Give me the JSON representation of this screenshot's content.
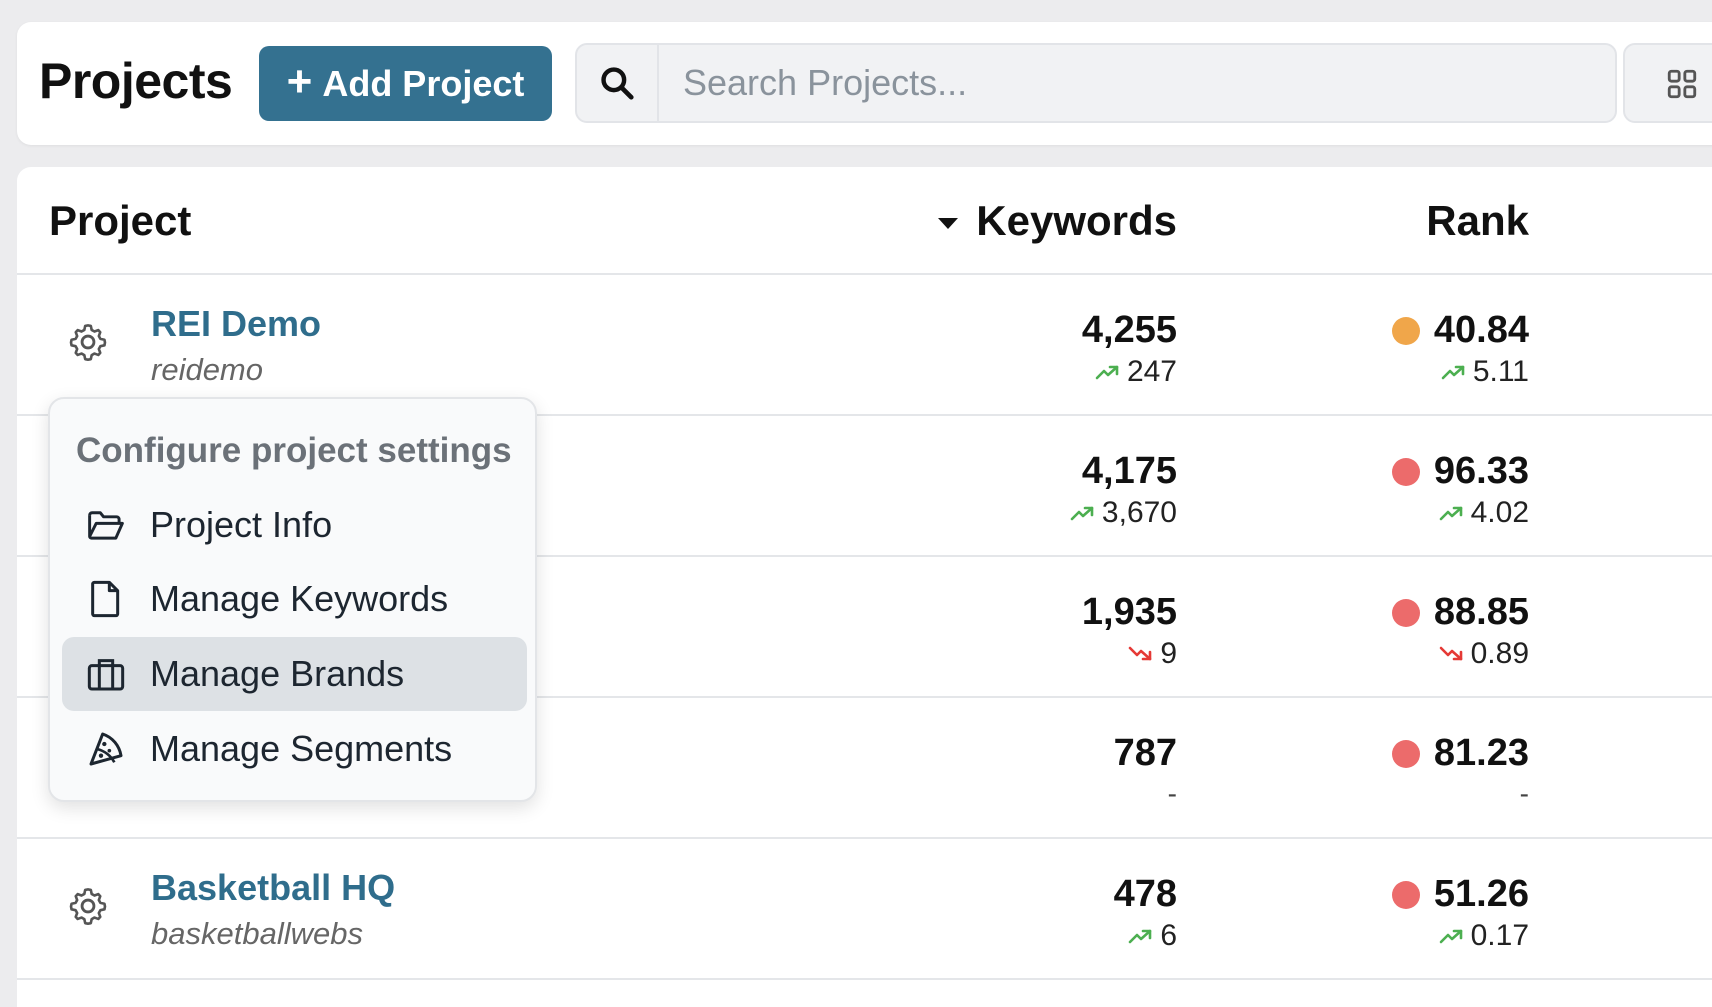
{
  "header": {
    "title": "Projects",
    "add_button_label": "Add Project",
    "search_placeholder": "Search Projects..."
  },
  "table": {
    "columns": {
      "project": "Project",
      "keywords": "Keywords",
      "rank": "Rank"
    },
    "rows": [
      {
        "name": "REI Demo",
        "slug": "reidemo",
        "keywords": "4,255",
        "kw_delta": "247",
        "kw_trend": "up",
        "rank": "40.84",
        "rank_delta": "5.11",
        "rank_trend": "up",
        "rank_color": "#f0a64a"
      },
      {
        "name": "",
        "slug": "",
        "keywords": "4,175",
        "kw_delta": "3,670",
        "kw_trend": "up",
        "rank": "96.33",
        "rank_delta": "4.02",
        "rank_trend": "up",
        "rank_color": "#ec6b6b"
      },
      {
        "name": "",
        "slug": "",
        "keywords": "1,935",
        "kw_delta": "9",
        "kw_trend": "down",
        "rank": "88.85",
        "rank_delta": "0.89",
        "rank_trend": "down",
        "rank_color": "#ec6b6b"
      },
      {
        "name": "",
        "slug": "",
        "keywords": "787",
        "kw_delta": "-",
        "kw_trend": "none",
        "rank": "81.23",
        "rank_delta": "-",
        "rank_trend": "none",
        "rank_color": "#ec6b6b"
      },
      {
        "name": "Basketball HQ",
        "slug": "basketballwebs",
        "keywords": "478",
        "kw_delta": "6",
        "kw_trend": "up",
        "rank": "51.26",
        "rank_delta": "0.17",
        "rank_trend": "up",
        "rank_color": "#ec6b6b"
      }
    ]
  },
  "menu": {
    "title": "Configure project settings",
    "items": [
      {
        "label": "Project Info",
        "icon": "folder-open-icon"
      },
      {
        "label": "Manage Keywords",
        "icon": "document-icon"
      },
      {
        "label": "Manage Brands",
        "icon": "briefcase-icon",
        "active": true
      },
      {
        "label": "Manage Segments",
        "icon": "pizza-slice-icon"
      }
    ]
  },
  "colors": {
    "accent": "#347190",
    "link": "#2f6d8c",
    "trend_up": "#4caf50",
    "trend_down": "#e53935",
    "rank_orange": "#f0a64a",
    "rank_red": "#ec6b6b"
  }
}
